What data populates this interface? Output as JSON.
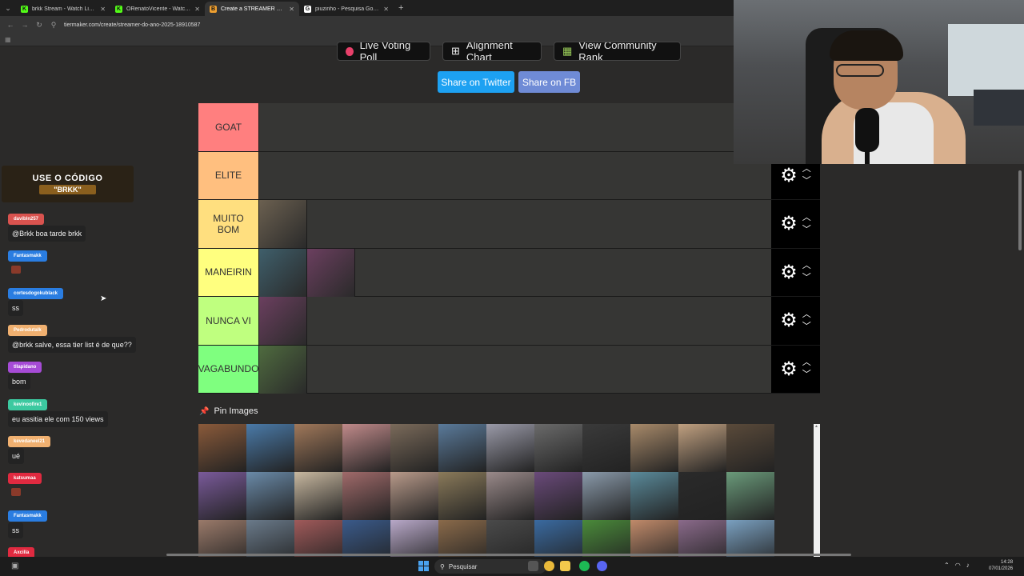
{
  "browser": {
    "tabs": [
      {
        "title": "brkk Stream - Watch Live on Ki",
        "fav": "K",
        "fav_color": "#53fc18",
        "active": false
      },
      {
        "title": "ORenatoVicente - Watch the Vi",
        "fav": "K",
        "fav_color": "#53fc18",
        "active": false
      },
      {
        "title": "Create a STREAMER DO ANO (",
        "fav": "B",
        "fav_color": "#f0a030",
        "active": true
      },
      {
        "title": "piuzinho - Pesquisa Google",
        "fav": "G",
        "fav_color": "#ffffff",
        "active": false
      }
    ],
    "url": "tiermaker.com/create/streamer-do-ano-2025-18910587"
  },
  "page": {
    "buttons": {
      "live_voting": "Live Voting Poll",
      "alignment_chart": "Alignment Chart",
      "community_rank": "View Community Rank",
      "share_twitter": "Share on Twitter",
      "share_fb": "Share on FB"
    },
    "tiers": [
      {
        "label": "GOAT",
        "color": "#ff7f7f",
        "items": []
      },
      {
        "label": "ELITE",
        "color": "#ffbf7f",
        "items": []
      },
      {
        "label": "MUITO BOM",
        "color": "#ffdf7f",
        "items": [
          "streamer-a"
        ]
      },
      {
        "label": "MANEIRIN",
        "color": "#ffff7f",
        "items": [
          "streamer-b",
          "streamer-c"
        ]
      },
      {
        "label": "NUNCA VI",
        "color": "#bfff7f",
        "items": [
          "streamer-d"
        ]
      },
      {
        "label": "VAGABUNDO",
        "color": "#7fff7f",
        "items": [
          "streamer-e"
        ]
      }
    ],
    "pin_images_label": "Pin Images",
    "pool_count": 36
  },
  "chat": {
    "promo": {
      "line1": "USE O CÓDIGO",
      "line2": "\"BRKK\""
    },
    "messages": [
      {
        "user": "davibln257",
        "color": "#d9534f",
        "text": "@Brkk boa tarde brkk"
      },
      {
        "user": "Fantasmakk",
        "color": "#2a7de1",
        "text": ""
      },
      {
        "user": "cortesdogokublack",
        "color": "#2a7de1",
        "text": "ss"
      },
      {
        "user": "Pedrodutalk",
        "color": "#f0b070",
        "text": "@brkk salve, essa tier list é de que??"
      },
      {
        "user": "tllapidano",
        "color": "#a64bd6",
        "text": "bom"
      },
      {
        "user": "kevinoofire1",
        "color": "#3cc9a0",
        "text": "eu assitia ele com 150 views"
      },
      {
        "user": "kevedaneel21",
        "color": "#f0b070",
        "text": "ué"
      },
      {
        "user": "katsumaa",
        "color": "#e02a40",
        "text": ""
      },
      {
        "user": "Fantasmakk",
        "color": "#2a7de1",
        "text": "ss"
      },
      {
        "user": "Axcilla",
        "color": "#e02a40",
        "text": ""
      }
    ]
  },
  "taskbar": {
    "search_placeholder": "Pesquisar",
    "time": "14:28",
    "date": "07/01/2026"
  }
}
